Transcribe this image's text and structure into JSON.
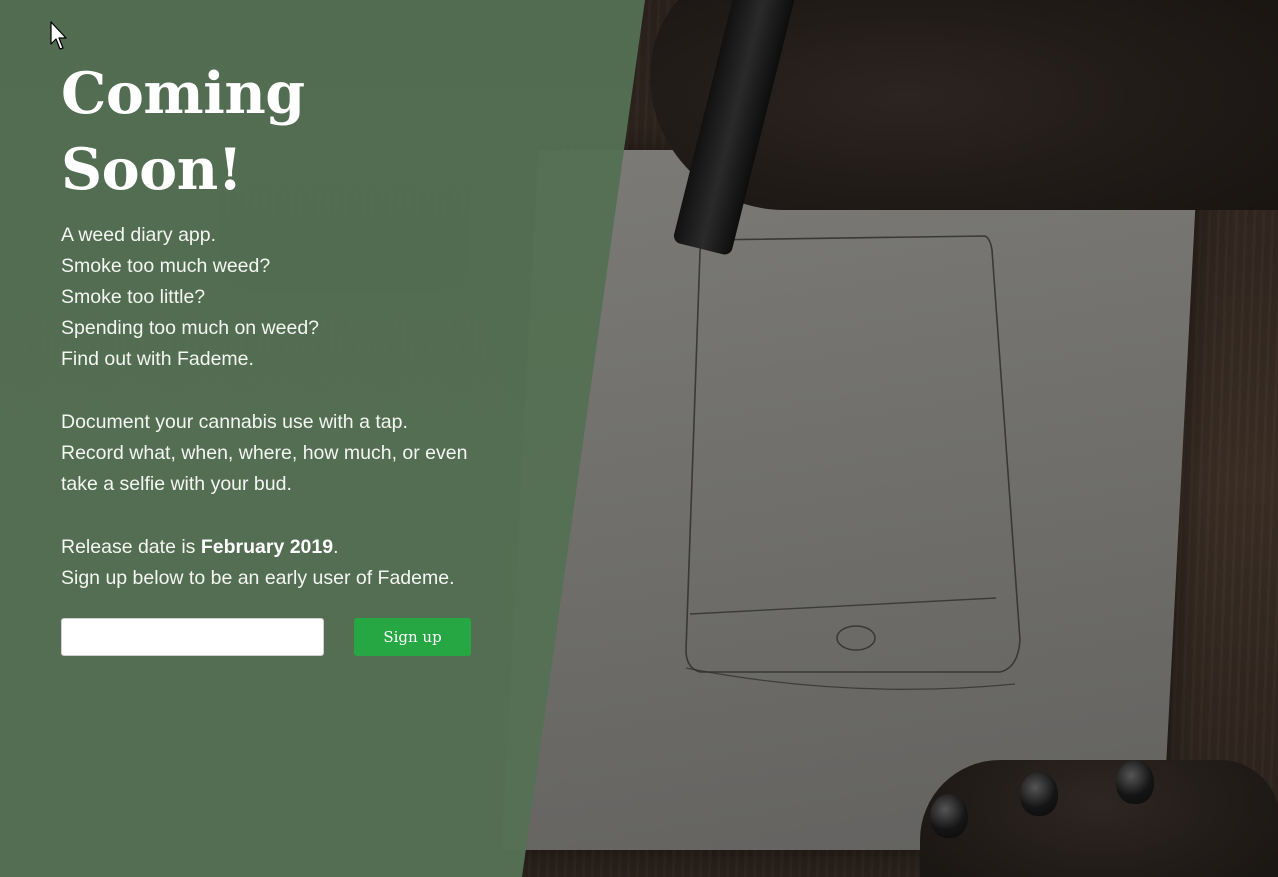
{
  "hero": {
    "title": "Coming Soon!",
    "intro_lines": [
      "A weed diary app.",
      "Smoke too much weed?",
      "Smoke too little?",
      "Spending too much on weed?",
      "Find out with Fademe."
    ],
    "description": "Document your cannabis use with a tap. Record what, when, where, how much, or even take a selfie with your bud.",
    "release_prefix": "Release date is ",
    "release_date": "February 2019",
    "release_suffix": ".",
    "signup_prompt": "Sign up below to be an early user of Fademe."
  },
  "signup_form": {
    "email_value": "",
    "email_placeholder": "",
    "button_label": "Sign up"
  },
  "colors": {
    "overlay": "#567156",
    "button": "#27a744",
    "text": "#ffffff"
  }
}
